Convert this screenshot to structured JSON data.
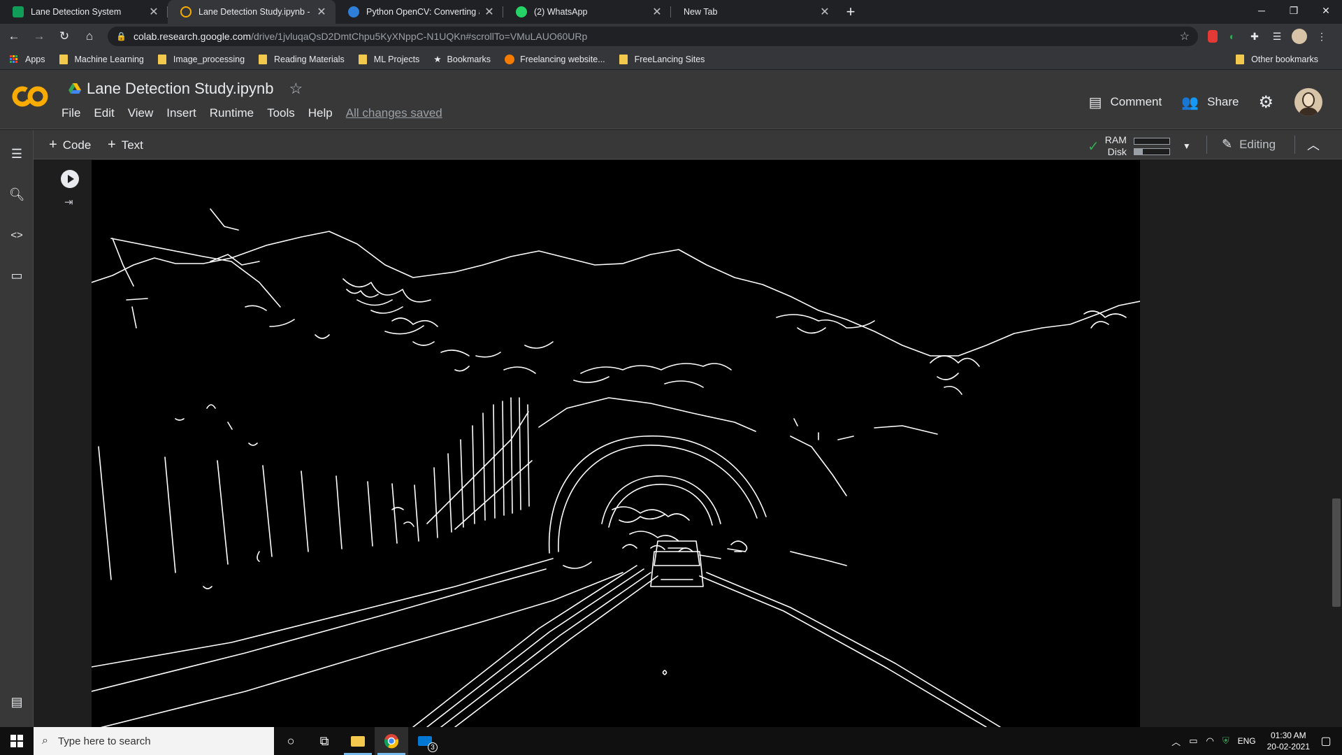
{
  "browser": {
    "tabs": [
      {
        "label": "Lane Detection System",
        "icon": "sheets-icon",
        "active": false
      },
      {
        "label": "Lane Detection Study.ipynb - Col",
        "icon": "colab-icon",
        "active": true
      },
      {
        "label": "Python OpenCV: Converting an i",
        "icon": "tutorialspoint-icon",
        "active": false
      },
      {
        "label": "(2) WhatsApp",
        "icon": "whatsapp-icon",
        "active": false
      },
      {
        "label": "New Tab",
        "icon": "",
        "active": false
      }
    ],
    "url_domain": "colab.research.google.com",
    "url_path": "/drive/1jvluqaQsD2DmtChpu5KyXNppC-N1UQKn#scrollTo=VMuLAUO60URp",
    "bookmarks": [
      "Apps",
      "Machine Learning",
      "Image_processing",
      "Reading Materials",
      "ML Projects",
      "Bookmarks",
      "Freelancing website...",
      "FreeLancing Sites"
    ],
    "other_bookmarks": "Other bookmarks"
  },
  "colab": {
    "title": "Lane Detection Study.ipynb",
    "menu": [
      "File",
      "Edit",
      "View",
      "Insert",
      "Runtime",
      "Tools",
      "Help"
    ],
    "save_status": "All changes saved",
    "comment_label": "Comment",
    "share_label": "Share",
    "add_code_label": "Code",
    "add_text_label": "Text",
    "ram_label": "RAM",
    "disk_label": "Disk",
    "ram_usage": 0.0,
    "disk_usage": 0.25,
    "editing_label": "Editing",
    "output_description": "edge-detection output image"
  },
  "taskbar": {
    "search_placeholder": "Type here to search",
    "mail_badge": "3",
    "language": "ENG",
    "time": "01:30 AM",
    "date": "20-02-2021"
  },
  "colors": {
    "accent_orange": "#f9ab00",
    "background": "#383838",
    "output_bg": "#000000"
  }
}
